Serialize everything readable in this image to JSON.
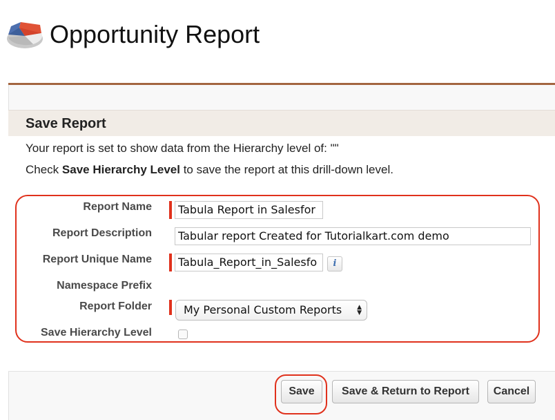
{
  "page": {
    "title": "Opportunity Report"
  },
  "icons": {
    "logo": "report-pie-chart-icon",
    "info": "info-icon",
    "select_arrows": "up-down-arrows-icon"
  },
  "section": {
    "title": "Save Report",
    "info_line1": "Your report is set to show data from the Hierarchy level of: \"\"",
    "info_line2_prefix": "Check ",
    "info_line2_bold": "Save Hierarchy Level",
    "info_line2_suffix": " to save the report at this drill-down level."
  },
  "form": {
    "report_name": {
      "label": "Report Name",
      "value": "Tabula Report in Salesfor",
      "required": true
    },
    "report_description": {
      "label": "Report Description",
      "value": "Tabular report Created for Tutorialkart.com demo"
    },
    "report_unique_name": {
      "label": "Report Unique Name",
      "value": "Tabula_Report_in_Salesfo",
      "required": true
    },
    "namespace_prefix": {
      "label": "Namespace Prefix"
    },
    "report_folder": {
      "label": "Report Folder",
      "value": "My Personal Custom Reports",
      "required": true
    },
    "save_hierarchy_level": {
      "label": "Save Hierarchy Level",
      "checked": false
    }
  },
  "buttons": {
    "save": "Save",
    "save_return": "Save & Return to Report",
    "cancel": "Cancel"
  },
  "colors": {
    "required": "#e0311c",
    "highlight": "#e0311c",
    "panel_border": "#a3653f",
    "section_header_bg": "#f1ece6"
  }
}
